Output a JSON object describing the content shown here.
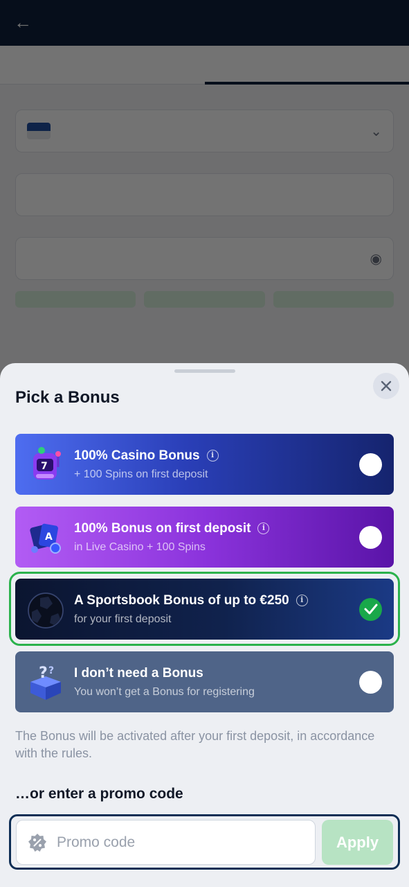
{
  "sheet": {
    "title": "Pick a Bonus",
    "bonuses": [
      {
        "title": "100% Casino Bonus",
        "subtitle": "+ 100 Spins on first deposit",
        "selected": false,
        "icon": "slot-machine-icon"
      },
      {
        "title": "100% Bonus on first deposit",
        "subtitle": "in Live Casino + 100 Spins",
        "selected": false,
        "icon": "playing-cards-icon"
      },
      {
        "title": "A Sportsbook Bonus of up to €250",
        "subtitle": "for your first deposit",
        "selected": true,
        "icon": "football-icon"
      },
      {
        "title": "I don’t need a Bonus",
        "subtitle": "You won’t get a Bonus for registering",
        "selected": false,
        "icon": "mystery-box-icon"
      }
    ],
    "note": "The Bonus will be activated after your first deposit, in accordance with the rules.",
    "promo": {
      "heading": "…or enter a promo code",
      "placeholder": "Promo code",
      "value": "",
      "apply_label": "Apply"
    }
  },
  "colors": {
    "selected_ring": "#2bb24c",
    "check": "#19a84a",
    "apply_disabled": "#b7e3c3",
    "promo_border": "#0e2e55"
  }
}
